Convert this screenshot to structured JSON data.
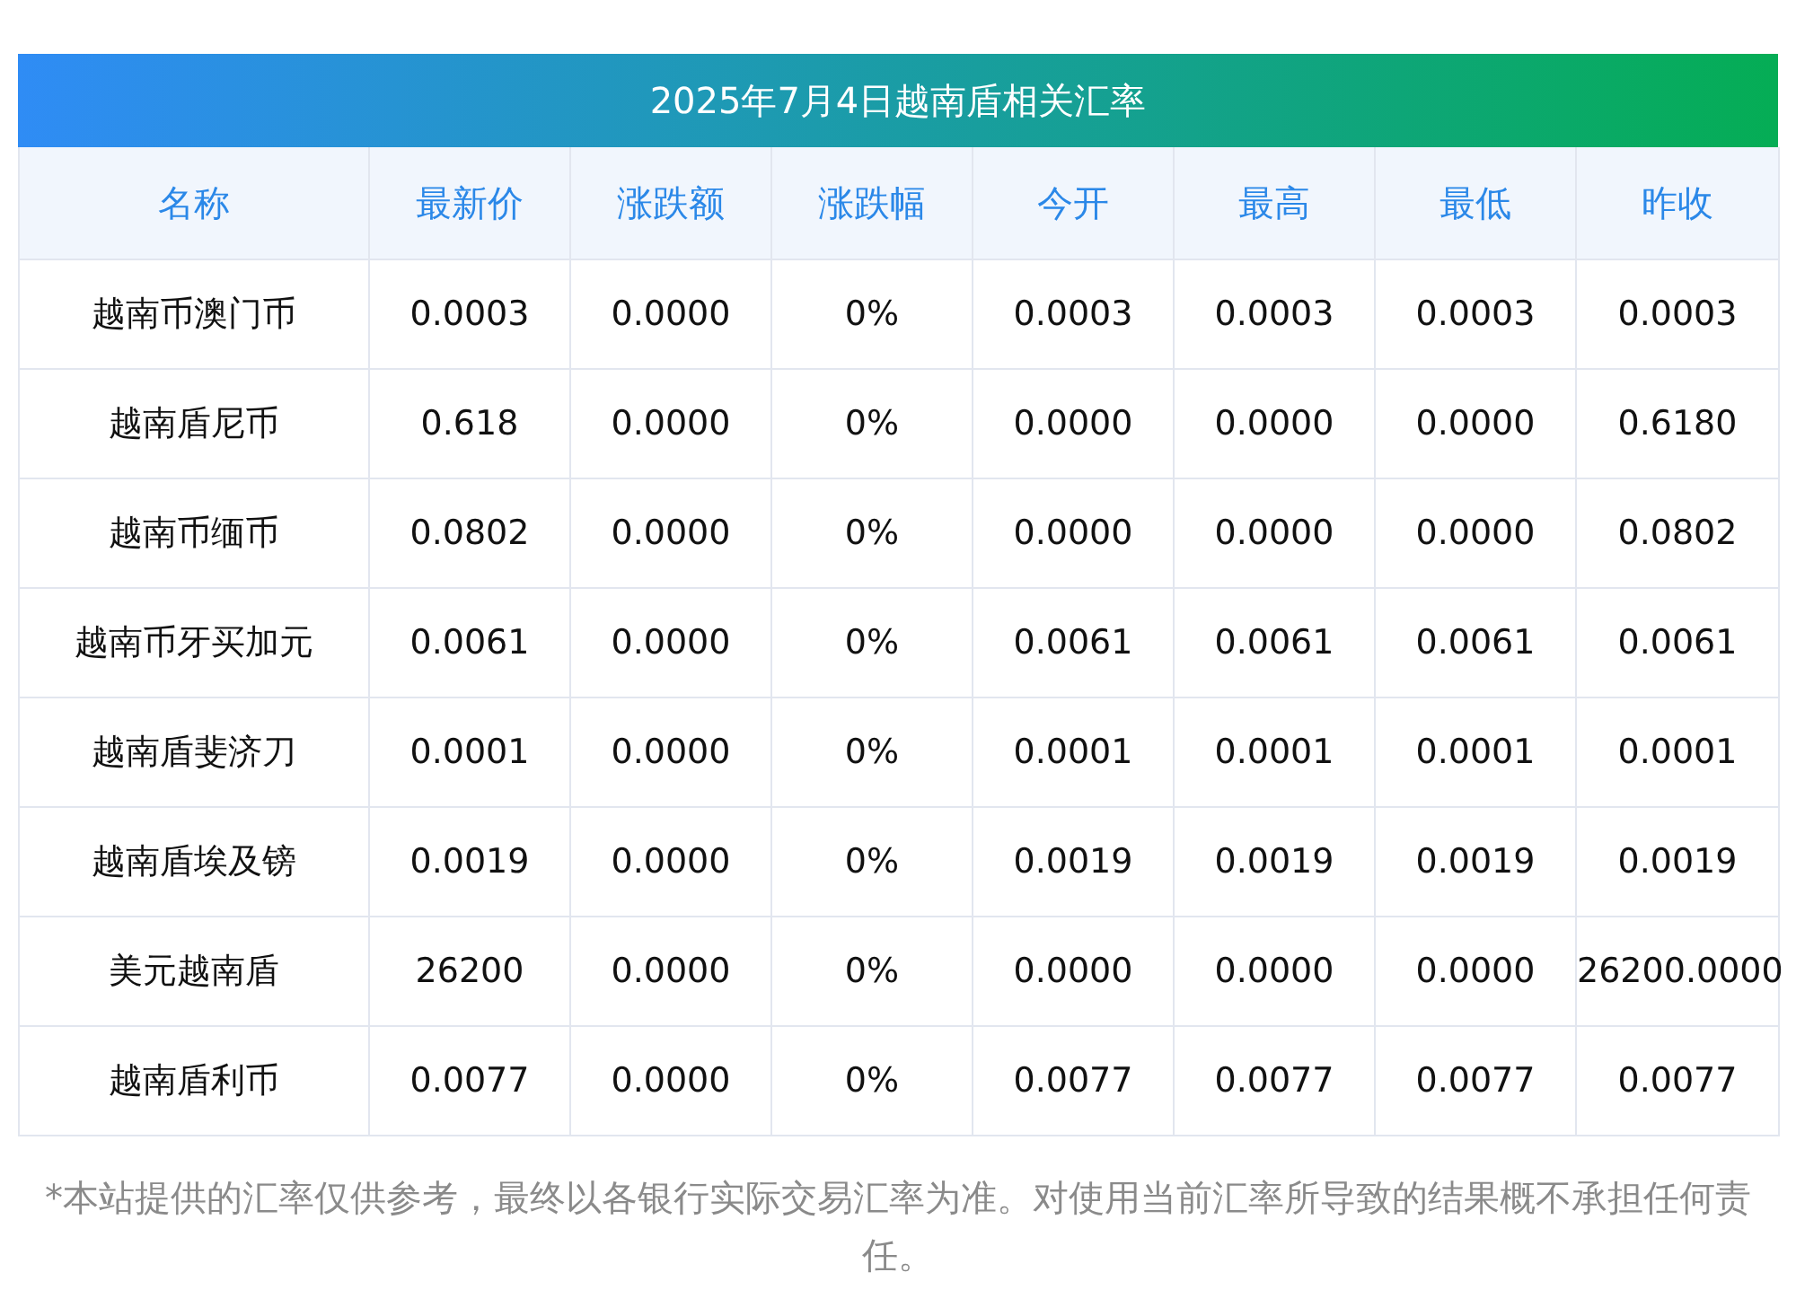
{
  "title": "2025年7月4日越南盾相关汇率",
  "columns": [
    "名称",
    "最新价",
    "涨跌额",
    "涨跌幅",
    "今开",
    "最高",
    "最低",
    "昨收"
  ],
  "rows": [
    [
      "越南币澳门币",
      "0.0003",
      "0.0000",
      "0%",
      "0.0003",
      "0.0003",
      "0.0003",
      "0.0003"
    ],
    [
      "越南盾尼币",
      "0.618",
      "0.0000",
      "0%",
      "0.0000",
      "0.0000",
      "0.0000",
      "0.6180"
    ],
    [
      "越南币缅币",
      "0.0802",
      "0.0000",
      "0%",
      "0.0000",
      "0.0000",
      "0.0000",
      "0.0802"
    ],
    [
      "越南币牙买加元",
      "0.0061",
      "0.0000",
      "0%",
      "0.0061",
      "0.0061",
      "0.0061",
      "0.0061"
    ],
    [
      "越南盾斐济刀",
      "0.0001",
      "0.0000",
      "0%",
      "0.0001",
      "0.0001",
      "0.0001",
      "0.0001"
    ],
    [
      "越南盾埃及镑",
      "0.0019",
      "0.0000",
      "0%",
      "0.0019",
      "0.0019",
      "0.0019",
      "0.0019"
    ],
    [
      "美元越南盾",
      "26200",
      "0.0000",
      "0%",
      "0.0000",
      "0.0000",
      "0.0000",
      "26200.0000"
    ],
    [
      "越南盾利币",
      "0.0077",
      "0.0000",
      "0%",
      "0.0077",
      "0.0077",
      "0.0077",
      "0.0077"
    ]
  ],
  "footnote": "*本站提供的汇率仅供参考，最终以各银行实际交易汇率为准。对使用当前汇率所导致的结果概不承担任何责任。"
}
